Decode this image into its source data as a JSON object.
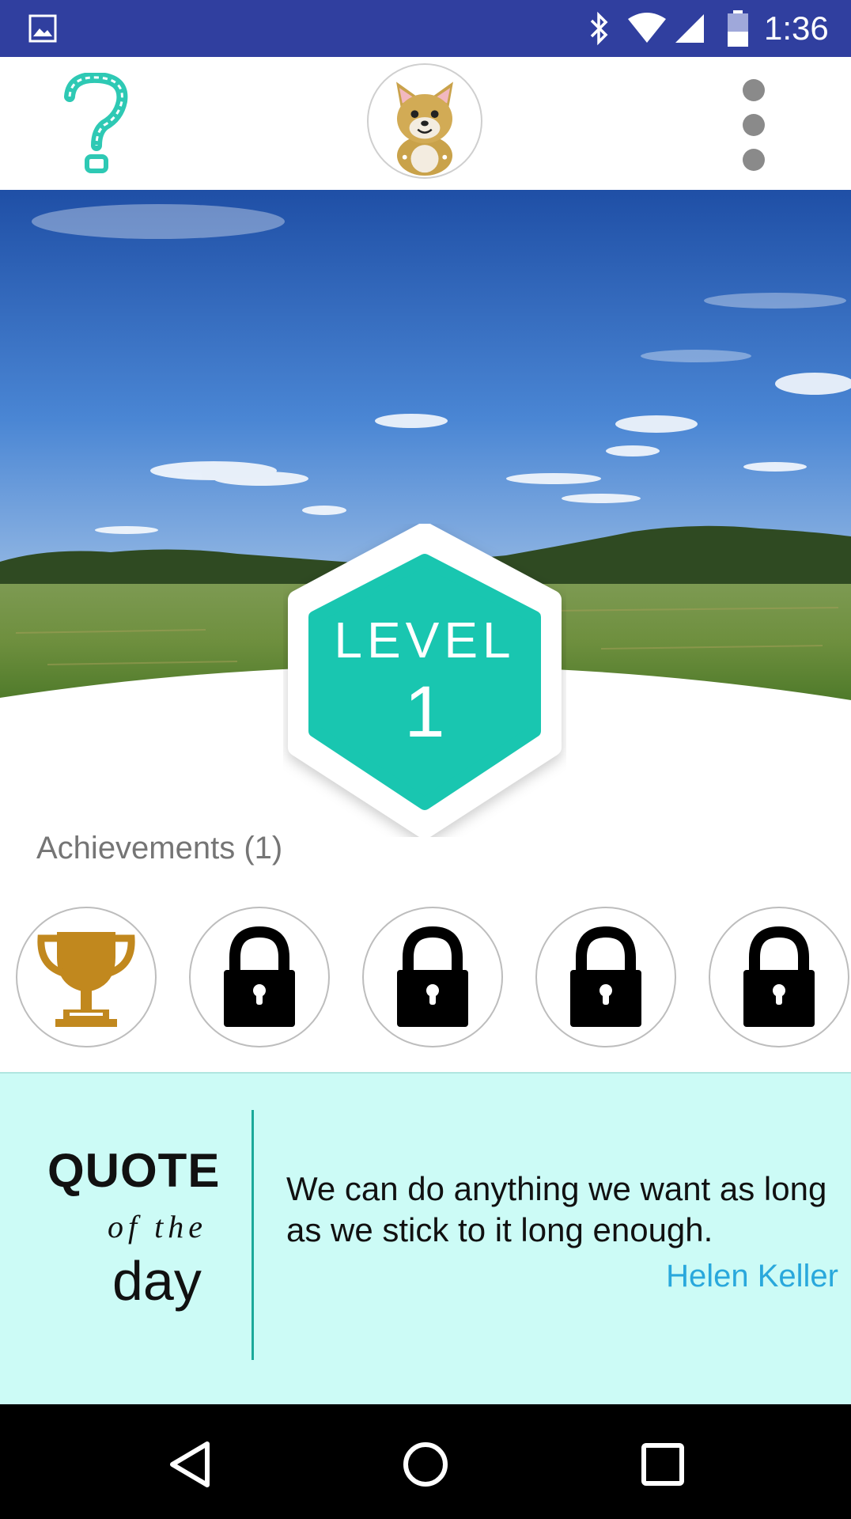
{
  "status_bar": {
    "time": "1:36",
    "icons": [
      "image-icon",
      "bluetooth-icon",
      "wifi-icon",
      "signal-icon",
      "battery-icon"
    ]
  },
  "app_bar": {
    "left_icon": "help-question-icon",
    "center_icon": "cat-avatar",
    "right_icon": "overflow-menu-icon"
  },
  "level": {
    "label": "LEVEL",
    "number": "1",
    "color": "#19c6b0"
  },
  "achievements": {
    "title": "Achievements (1)",
    "items": [
      {
        "icon": "trophy-icon",
        "unlocked": true
      },
      {
        "icon": "lock-icon",
        "unlocked": false
      },
      {
        "icon": "lock-icon",
        "unlocked": false
      },
      {
        "icon": "lock-icon",
        "unlocked": false
      },
      {
        "icon": "lock-icon",
        "unlocked": false
      }
    ]
  },
  "quote": {
    "heading_quote": "QUOTE",
    "heading_ofthe": "of the",
    "heading_day": "day",
    "text": "We can do anything we want as long as we stick to it long enough.",
    "author": "Helen Keller",
    "panel_color": "#ccfbf6",
    "author_color": "#29a8dc"
  },
  "nav_bar": {
    "buttons": [
      "back-icon",
      "home-icon",
      "recents-icon"
    ]
  }
}
